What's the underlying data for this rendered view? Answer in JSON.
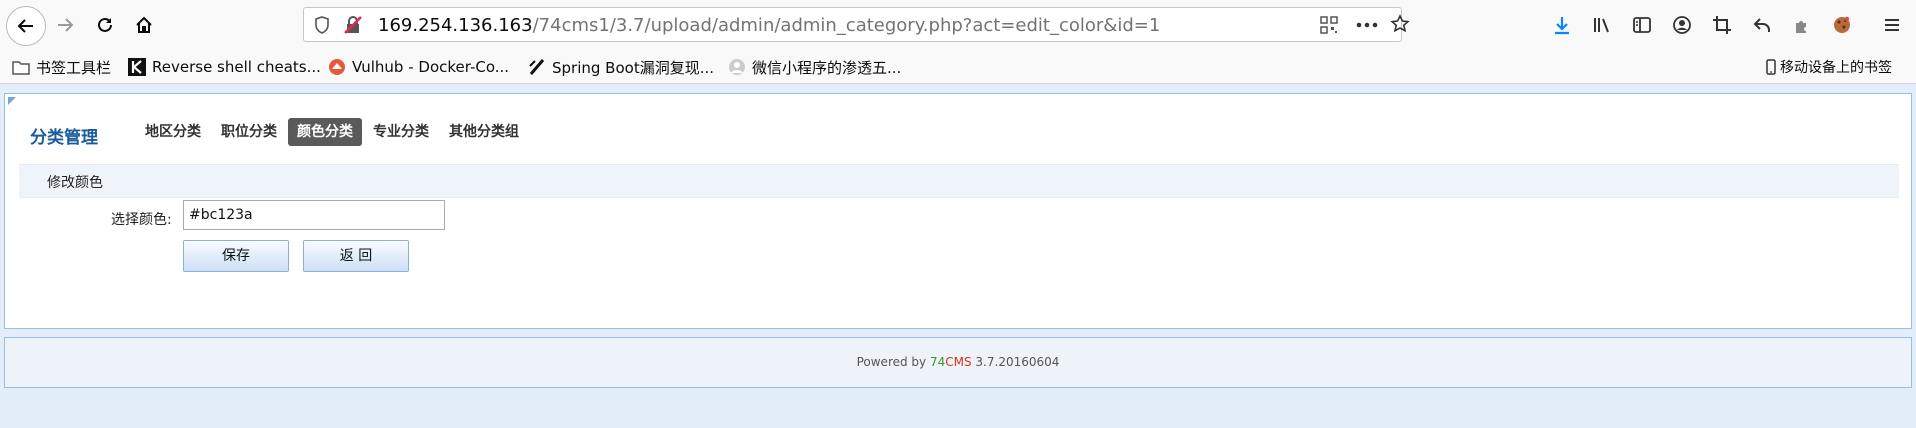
{
  "browser": {
    "url_host": "169.254.136.163",
    "url_path": "/74cms1/3.7/upload/admin/admin_category.php?act=edit_color&id=1",
    "bookmarks": [
      {
        "label": "书签工具栏",
        "icon": "folder-icon"
      },
      {
        "label": "Reverse shell cheats...",
        "icon": "k-logo-icon"
      },
      {
        "label": "Vulhub - Docker-Co...",
        "icon": "vulhub-icon"
      },
      {
        "label": "Spring Boot漏洞复现...",
        "icon": "slash-logo-icon"
      },
      {
        "label": "微信小程序的渗透五...",
        "icon": "globe-icon"
      }
    ],
    "mobile_bookmarks": "移动设备上的书签"
  },
  "nav": {
    "title": "分类管理",
    "tabs": [
      {
        "label": "地区分类",
        "active": false
      },
      {
        "label": "职位分类",
        "active": false
      },
      {
        "label": "颜色分类",
        "active": true
      },
      {
        "label": "专业分类",
        "active": false
      },
      {
        "label": "其他分类组",
        "active": false
      }
    ]
  },
  "form": {
    "section_title": "修改颜色",
    "color_label": "选择颜色:",
    "color_value": "#bc123a",
    "save_label": "保存",
    "back_label": "返 回"
  },
  "footer": {
    "prefix": "Powered by ",
    "brand_a": "74",
    "brand_b": "CMS",
    "version": " 3.7.20160604"
  },
  "colors": {
    "nav_title": "#1a5c9b",
    "active_tab": "#5a5a5a",
    "brand_green": "#3a9b2a",
    "brand_red": "#d8321a",
    "download_blue": "#0a84ff"
  }
}
